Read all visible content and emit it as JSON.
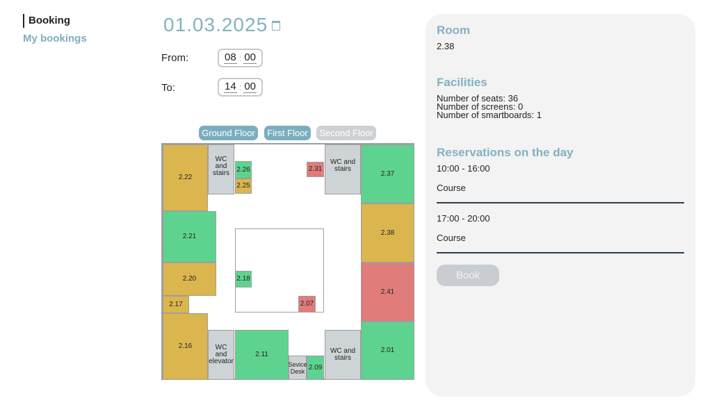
{
  "nav": {
    "active": "Booking",
    "link": "My bookings"
  },
  "date": "01.03.2025",
  "time": {
    "from_label": "From:",
    "from_h": "08",
    "from_m": "00",
    "to_label": "To:",
    "to_h": "14",
    "to_m": "00",
    "sep": ":"
  },
  "floors": {
    "ground": "Ground Floor",
    "first": "First Floor",
    "second": "Second Floor"
  },
  "rooms": {
    "r222": "2.22",
    "r226": "2.26",
    "r225": "2.25",
    "r231": "2.31",
    "r237": "2.37",
    "r221": "2.21",
    "r238": "2.38",
    "r220": "2.20",
    "r218": "2.18",
    "r207": "2.07",
    "r241": "2.41",
    "r217": "2.17",
    "r216": "2.16",
    "r211": "2.11",
    "r209": "2.09",
    "r201": "2.01",
    "wc_stairs": "WC and stairs",
    "wc_elevator": "WC and elevator",
    "service_desk": "Sevice Desk"
  },
  "panel": {
    "room_heading": "Room",
    "room_value": "2.38",
    "facilities_heading": "Facilities",
    "seats": "Number of seats: 36",
    "screens": "Number of screens: 0",
    "smartboards": "Number of smartboards: 1",
    "reservations_heading": "Reservations on the day",
    "reservations": [
      {
        "time": "10:00 - 16:00",
        "title": "Course"
      },
      {
        "time": "17:00 - 20:00",
        "title": "Course"
      }
    ],
    "book": "Book"
  },
  "colors": {
    "accent": "#84b1c1",
    "available": "#5ed38f",
    "partial": "#dbb64f",
    "booked": "#e07c7a",
    "facility": "#ced3d6",
    "active_tab": "#7aaebf",
    "inactive_tab": "#cdd1d4"
  }
}
